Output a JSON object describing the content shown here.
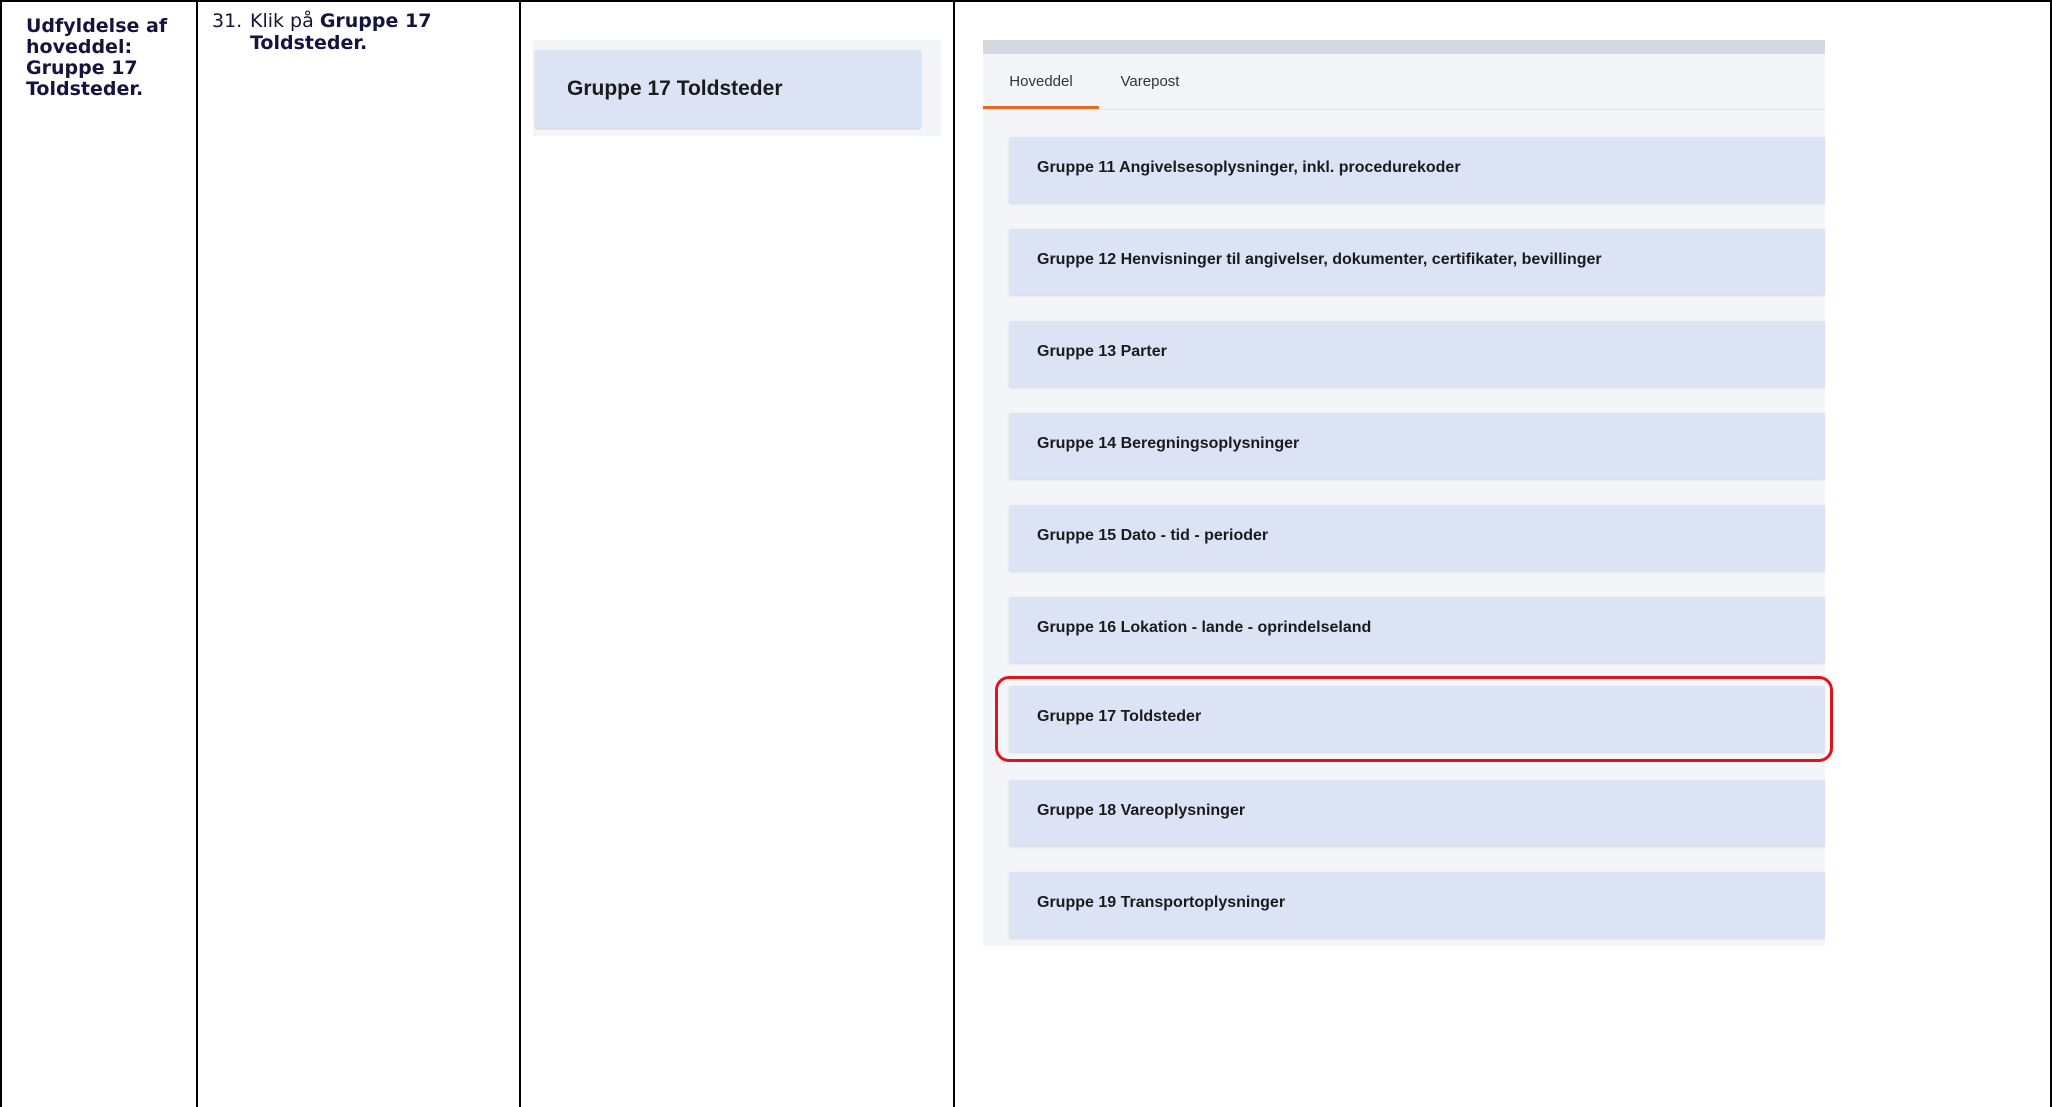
{
  "step": {
    "title": "Udfyldelse af hoveddel: Gruppe 17 Toldsteder.",
    "number": "31.",
    "instruction_prefix": "Klik på ",
    "instruction_bold_line1": "Gruppe 17",
    "instruction_bold_line2": "Toldsteder."
  },
  "zoom": {
    "label": "Gruppe 17 Toldsteder"
  },
  "screenshot": {
    "tabs": [
      {
        "label": "Hoveddel",
        "active": true
      },
      {
        "label": "Varepost",
        "active": false
      }
    ],
    "groups": [
      {
        "label": "Gruppe 11 Angivelsesoplysninger, inkl. procedurekoder"
      },
      {
        "label": "Gruppe 12 Henvisninger til angivelser, dokumenter, certifikater, bevillinger"
      },
      {
        "label": "Gruppe 13 Parter"
      },
      {
        "label": "Gruppe 14 Beregningsoplysninger"
      },
      {
        "label": "Gruppe 15 Dato - tid - perioder"
      },
      {
        "label": "Gruppe 16 Lokation - lande - oprindelseland"
      },
      {
        "label": "Gruppe 17 Toldsteder"
      },
      {
        "label": "Gruppe 18 Vareoplysninger"
      },
      {
        "label": "Gruppe 19 Transportoplysninger"
      }
    ],
    "highlighted_group": "Gruppe 17 Toldsteder",
    "active_tab_color": "#e36a1f",
    "highlight_color": "#e0141e",
    "card_color": "#dbe3f4"
  }
}
